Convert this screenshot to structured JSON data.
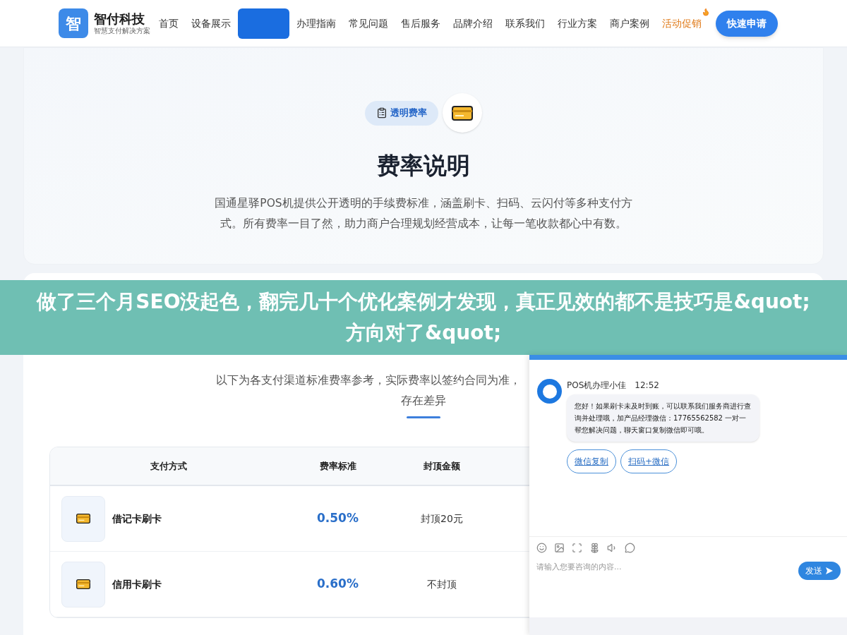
{
  "header": {
    "logo": {
      "mark": "智",
      "name": "智付科技",
      "tagline": "智慧支付解决方案"
    },
    "nav": [
      {
        "label": "首页",
        "selected": false,
        "kind": "link"
      },
      {
        "label": "设备展示",
        "selected": false,
        "kind": "link"
      },
      {
        "selected": true,
        "kind": "link"
      },
      {
        "label": "办理指南",
        "selected": false,
        "kind": "link"
      },
      {
        "label": "常见问题",
        "selected": false,
        "kind": "link"
      },
      {
        "label": "售后服务",
        "selected": false,
        "kind": "link"
      },
      {
        "label": "品牌介绍",
        "selected": false,
        "kind": "link"
      },
      {
        "label": "联系我们",
        "selected": false,
        "kind": "link"
      },
      {
        "label": "行业方案",
        "selected": false,
        "kind": "link"
      },
      {
        "label": "商户案例",
        "selected": false,
        "kind": "link"
      },
      {
        "label": "活动促销",
        "selected": false,
        "kind": "promo"
      }
    ],
    "cta": "快速申请"
  },
  "hero": {
    "badge": "透明费率",
    "title": "费率说明",
    "description": "国通星驿POS机提供公开透明的手续费标准，涵盖刷卡、扫码、云闪付等多种支付方式。所有费率一目了然，助力商户合理规划经营成本，让每一笔收款都心中有数。"
  },
  "banner": {
    "title": "做了三个月SEO没起色，翻完几十个优化案例才发现，真正见效的都不是技巧是&quot;方向对了&quot;"
  },
  "rates": {
    "intro": [
      "以下为各支付渠道标准费率参考，实际费率以签约合同为准，",
      "存在差异"
    ],
    "columns": [
      "支付方式",
      "费率标准",
      "封顶金额"
    ],
    "rows": [
      {
        "name": "借记卡刷卡",
        "rate": "0.50%",
        "cap": "封顶20元"
      },
      {
        "name": "信用卡刷卡",
        "rate": "0.60%",
        "cap": "不封顶"
      }
    ]
  },
  "chat": {
    "agent": "POS机办理小佳",
    "time": "12:52",
    "message": "您好！如果刷卡未及时到账，可以联系我们服务商进行查询并处理哦，加产品经理微信：17765562582 一对一帮您解决问题，聊天窗口复制微信即可哦。",
    "actions": [
      "微信复制",
      "扫码+微信"
    ],
    "placeholder": "请输入您要咨询的内容...",
    "send": "发送"
  }
}
